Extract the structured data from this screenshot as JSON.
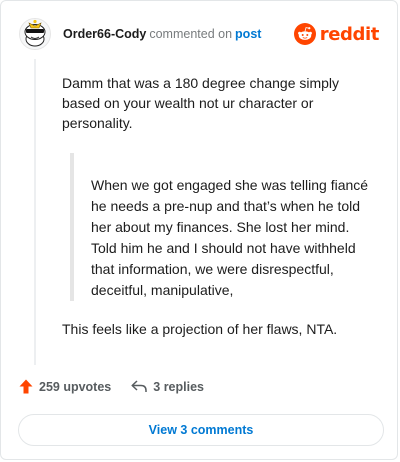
{
  "comment": {
    "author": "Order66-Cody",
    "action_text": "commented on",
    "post_link": "post",
    "brand": "reddit",
    "paragraphs": [
      "Damm that was a 180 degree change simply based on your wealth not ur character or personality."
    ],
    "quote": "When we got engaged she was telling fiancé he needs a pre-nup and that’s when he told her about my finances. She lost her mind. Told him he and I should not have withheld that information, we were disrespectful, deceitful, manipulative,",
    "closing": "This feels like a projection of her flaws, NTA."
  },
  "actions": {
    "upvotes": "259 upvotes",
    "replies": "3 replies"
  },
  "footer": {
    "view_comments": "View 3 comments"
  },
  "icons": {
    "avatar": "snoo-avatar-icon",
    "brand": "reddit-logo-icon",
    "upvote": "upvote-arrow-icon",
    "reply": "reply-arrow-icon"
  },
  "colors": {
    "brand": "#ff4500",
    "link": "#0079d3",
    "upvote": "#ff4500"
  }
}
